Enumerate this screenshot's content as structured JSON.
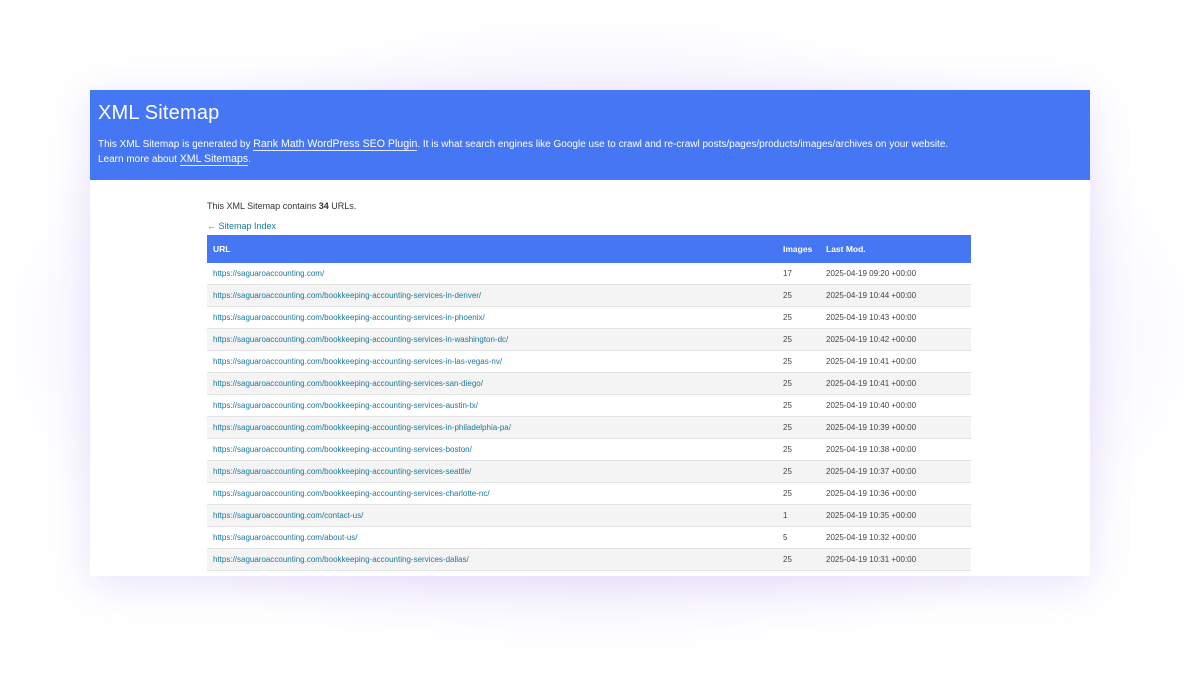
{
  "header": {
    "title": "XML Sitemap",
    "desc_before": "This XML Sitemap is generated by ",
    "plugin_link": "Rank Math WordPress SEO Plugin",
    "desc_after": ". It is what search engines like Google use to crawl and re-crawl posts/pages/products/images/archives on your website.",
    "learn_before": "Learn more about ",
    "learn_link": "XML Sitemaps",
    "learn_after": "."
  },
  "summary": {
    "before": "This XML Sitemap contains ",
    "count": "34",
    "after": " URLs."
  },
  "back_link": "← Sitemap Index",
  "table": {
    "headers": {
      "url": "URL",
      "images": "Images",
      "last_mod": "Last Mod."
    },
    "rows": [
      {
        "url": "https://saguaroaccounting.com/",
        "images": "17",
        "last_mod": "2025-04-19 09:20 +00:00"
      },
      {
        "url": "https://saguaroaccounting.com/bookkeeping-accounting-services-in-denver/",
        "images": "25",
        "last_mod": "2025-04-19 10:44 +00:00"
      },
      {
        "url": "https://saguaroaccounting.com/bookkeeping-accounting-services-in-phoenix/",
        "images": "25",
        "last_mod": "2025-04-19 10:43 +00:00"
      },
      {
        "url": "https://saguaroaccounting.com/bookkeeping-accounting-services-in-washington-dc/",
        "images": "25",
        "last_mod": "2025-04-19 10:42 +00:00"
      },
      {
        "url": "https://saguaroaccounting.com/bookkeeping-accounting-services-in-las-vegas-nv/",
        "images": "25",
        "last_mod": "2025-04-19 10:41 +00:00"
      },
      {
        "url": "https://saguaroaccounting.com/bookkeeping-accounting-services-san-diego/",
        "images": "25",
        "last_mod": "2025-04-19 10:41 +00:00"
      },
      {
        "url": "https://saguaroaccounting.com/bookkeeping-accounting-services-austin-tx/",
        "images": "25",
        "last_mod": "2025-04-19 10:40 +00:00"
      },
      {
        "url": "https://saguaroaccounting.com/bookkeeping-accounting-services-in-philadelphia-pa/",
        "images": "25",
        "last_mod": "2025-04-19 10:39 +00:00"
      },
      {
        "url": "https://saguaroaccounting.com/bookkeeping-accounting-services-boston/",
        "images": "25",
        "last_mod": "2025-04-19 10:38 +00:00"
      },
      {
        "url": "https://saguaroaccounting.com/bookkeeping-accounting-services-seattle/",
        "images": "25",
        "last_mod": "2025-04-19 10:37 +00:00"
      },
      {
        "url": "https://saguaroaccounting.com/bookkeeping-accounting-services-charlotte-nc/",
        "images": "25",
        "last_mod": "2025-04-19 10:36 +00:00"
      },
      {
        "url": "https://saguaroaccounting.com/contact-us/",
        "images": "1",
        "last_mod": "2025-04-19 10:35 +00:00"
      },
      {
        "url": "https://saguaroaccounting.com/about-us/",
        "images": "5",
        "last_mod": "2025-04-19 10:32 +00:00"
      },
      {
        "url": "https://saguaroaccounting.com/bookkeeping-accounting-services-dallas/",
        "images": "25",
        "last_mod": "2025-04-19 10:31 +00:00"
      }
    ]
  },
  "colors": {
    "header_bg": "#4576f3",
    "link": "#1a7a9a"
  }
}
